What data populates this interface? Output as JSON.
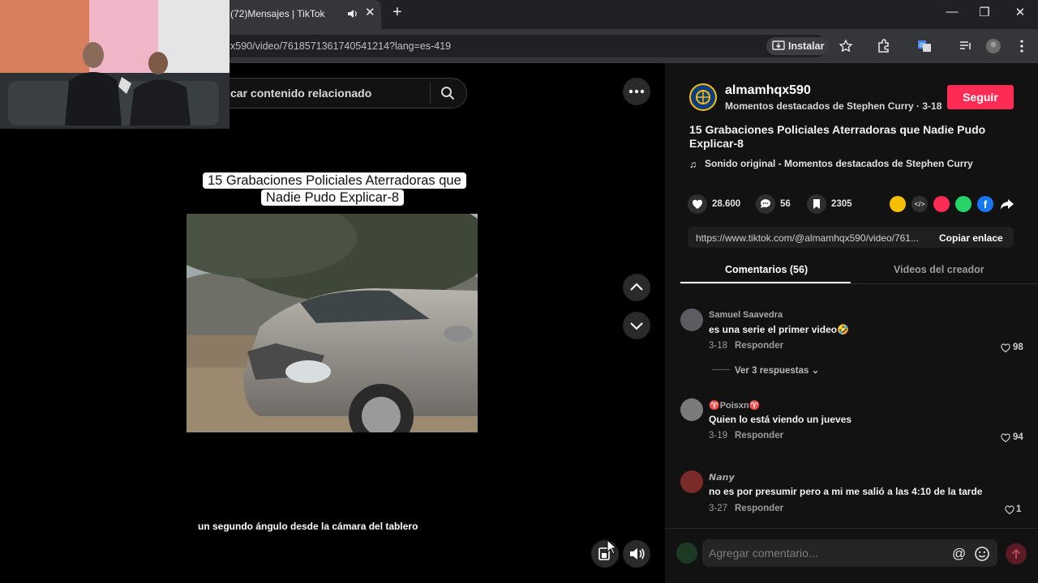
{
  "browser": {
    "tab_title": "(72)Mensajes | TikTok",
    "url": "x590/video/7618571361740541214?lang=es-419",
    "install_label": "Instalar"
  },
  "search": {
    "placeholder": "car contenido relacionado"
  },
  "video": {
    "title": "15 Grabaciones Policiales Aterradoras que Nadie Pudo Explicar-8",
    "caption": "un segundo ángulo desde la cámara del tablero"
  },
  "author": {
    "username": "almamhqx590",
    "subtitle": "Momentos destacados de Stephen Curry · 3-18",
    "follow_label": "Seguir"
  },
  "description": "15 Grabaciones Policiales Aterradoras que Nadie Pudo Explicar-8",
  "sound": "Sonido original - Momentos destacados de Stephen Curry",
  "stats": {
    "likes": "28.600",
    "comments": "56",
    "saves": "2305"
  },
  "link": {
    "url": "https://www.tiktok.com/@almamhqx590/video/761...",
    "copy_label": "Copiar enlace"
  },
  "tabs": {
    "comments": "Comentarios (56)",
    "creator": "Videos del creador"
  },
  "comments": [
    {
      "user": "Samuel Saavedra",
      "text": "es una serie el primer video🤣",
      "date": "3-18",
      "reply": "Responder",
      "likes": "98"
    },
    {
      "user": "♈Poisxn♈",
      "text": "Quien lo está viendo un jueves",
      "date": "3-19",
      "reply": "Responder",
      "likes": "94"
    },
    {
      "user": "𝙉𝙖𝙣𝙮",
      "text": "no es por presumir pero a mi me salió a las 4:10 de la tarde",
      "date": "3-27",
      "reply": "Responder",
      "likes": "1"
    }
  ],
  "view_replies": "Ver 3 respuestas",
  "comment_input": {
    "placeholder": "Agregar comentario..."
  },
  "colors": {
    "accent": "#fe2c55",
    "panel": "#121212"
  }
}
